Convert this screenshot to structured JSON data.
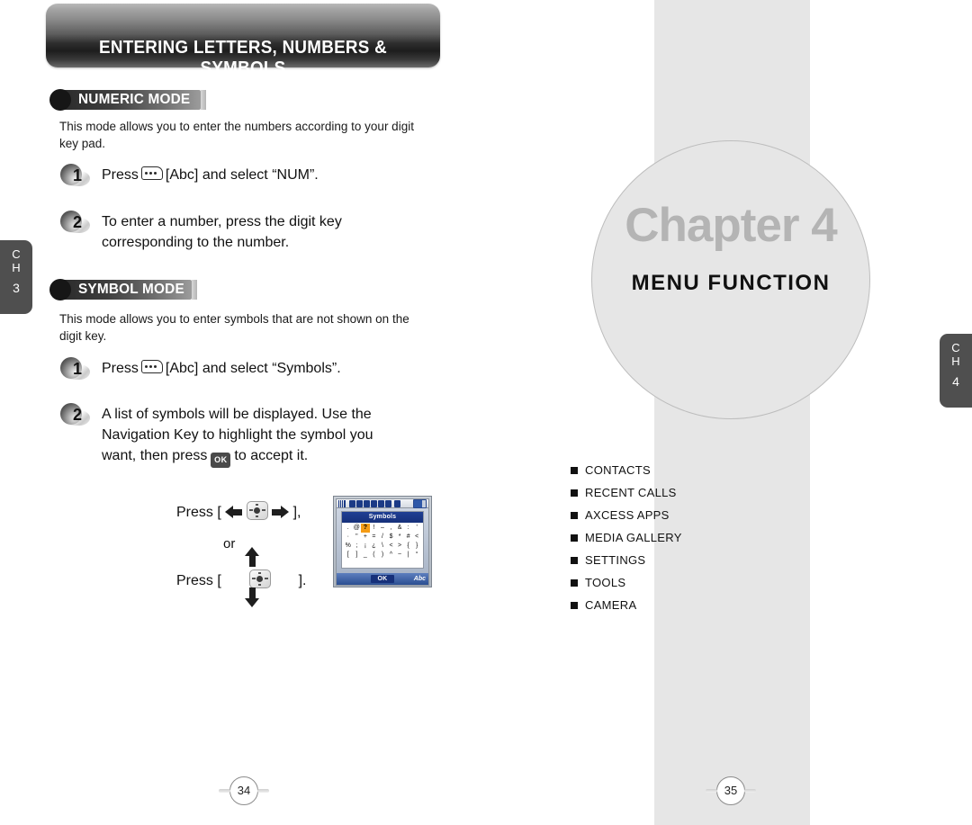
{
  "left_page": {
    "header_title": "ENTERING LETTERS, NUMBERS & SYMBOLS",
    "sections": [
      {
        "label": "NUMERIC MODE",
        "paragraph": "This mode allows you to enter the numbers according to your digit key pad.",
        "steps": [
          {
            "number": "1",
            "text_before": "Press",
            "key_icon": "abc-key-icon",
            "text_after": "[Abc] and select “NUM”."
          },
          {
            "number": "2",
            "text": "To enter a number, press the digit key corresponding to the number."
          }
        ]
      },
      {
        "label": "SYMBOL MODE",
        "paragraph": "This mode allows you to enter symbols that are not shown on the digit key.",
        "steps": [
          {
            "number": "1",
            "text_before": "Press",
            "key_icon": "abc-key-icon",
            "text_after": "[Abc] and select “Symbols”."
          },
          {
            "number": "2",
            "text_before": "A list of symbols will be displayed.  Use the Navigation Key to highlight the symbol you want, then press",
            "key_icon": "ok-key-icon",
            "text_after": "to accept it."
          }
        ]
      }
    ],
    "nav_instructions": {
      "line1_prefix": "Press [",
      "line1_suffix": "],",
      "or": "or",
      "line2_prefix": "Press [",
      "line2_suffix": "].",
      "left_arrow": "left-arrow-icon",
      "right_arrow": "right-arrow-icon",
      "up_arrow": "up-arrow-icon",
      "down_arrow": "down-arrow-icon",
      "nav_key": "navigation-key-icon"
    },
    "phone": {
      "dialog_title": "Symbols",
      "symbols": [
        ".",
        "@",
        "?",
        "!",
        "–",
        ",",
        "&",
        ":",
        "'",
        "·",
        "\"",
        "+",
        "=",
        "/",
        "$",
        "*",
        "#",
        "<",
        "%",
        ";",
        "¡",
        "¿",
        "\\",
        "<",
        ">",
        "{",
        "}",
        "[",
        "]",
        "_",
        "(",
        ")",
        "^",
        "~",
        "|",
        "°"
      ],
      "selected_symbol": "?",
      "selected_index": 2,
      "softkey_left": "OK",
      "softkey_right": "Abc",
      "status_icons": [
        "signal-icon",
        "phone-icon",
        "lock-icon",
        "alert-icon",
        "message-icon",
        "music-icon",
        "bluetooth-icon",
        "data-icon",
        "battery-icon"
      ]
    },
    "tab": {
      "ch": "C\nH",
      "ch_line1": "C",
      "ch_line2": "H",
      "number": "3"
    },
    "page_number": "34"
  },
  "right_page": {
    "chapter_word": "Chapter 4",
    "chapter_subtitle": "MENU FUNCTION",
    "toc": [
      "CONTACTS",
      "RECENT CALLS",
      "AXCESS APPS",
      "MEDIA GALLERY",
      "SETTINGS",
      "TOOLS",
      "CAMERA"
    ],
    "tab": {
      "ch_line1": "C",
      "ch_line2": "H",
      "number": "4"
    },
    "page_number": "35"
  },
  "colors": {
    "panel_gray": "#e6e6e6",
    "tab_gray": "#4f4f4f",
    "chapter_word_gray": "#b4b4b4",
    "highlight_orange": "#f59c14",
    "phone_title_blue": "#1f3f94"
  }
}
